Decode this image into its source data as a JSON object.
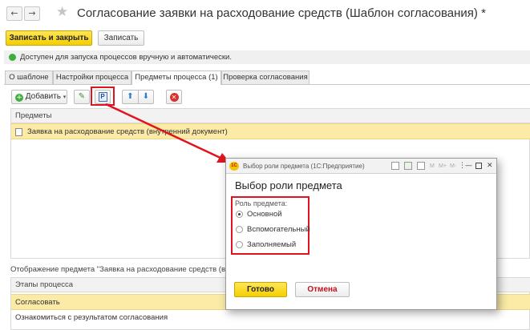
{
  "header": {
    "back_glyph": "←",
    "forward_glyph": "→",
    "title": "Согласование заявки на расходование средств (Шаблон согласования) *"
  },
  "toolbar": {
    "save_close_label": "Записать и закрыть",
    "save_label": "Записать"
  },
  "notice": {
    "text": "Доступен для запуска процессов вручную и автоматически.",
    "status_color": "#3fae3f"
  },
  "tabs": [
    {
      "label": "О шаблоне"
    },
    {
      "label": "Настройки процесса"
    },
    {
      "label": "Предметы процесса (1)"
    },
    {
      "label": "Проверка согласования"
    }
  ],
  "subjects_toolbar": {
    "add_label": "Добавить",
    "role_button_letter": "Р"
  },
  "subjects_grid": {
    "header": "Предметы",
    "rows": [
      "Заявка на расходование средств (внутренний документ)"
    ]
  },
  "display_caption": "Отображение предмета \"Заявка на расходование средств (внутр",
  "stages_grid": {
    "header": "Этапы процесса",
    "rows": [
      "Согласовать",
      "Ознакомиться с результатом согласования"
    ]
  },
  "dialog": {
    "window_title": "Выбор роли предмета",
    "app_suffix": "(1С:Предприятие)",
    "logo_text": "1С",
    "heading": "Выбор роли предмета",
    "field_label": "Роль предмета:",
    "options": [
      "Основной",
      "Вспомогательный",
      "Заполняемый"
    ],
    "selected_option": "Основной",
    "titlebar_m_label": "M",
    "titlebar_mplus_label": "M+",
    "titlebar_mminus_label": "M-",
    "ok_label": "Готово",
    "cancel_label": "Отмена"
  },
  "colors": {
    "primary_button": "#f5cf00",
    "selected_row": "#fbeba7",
    "highlight_frame": "#e0141e"
  }
}
